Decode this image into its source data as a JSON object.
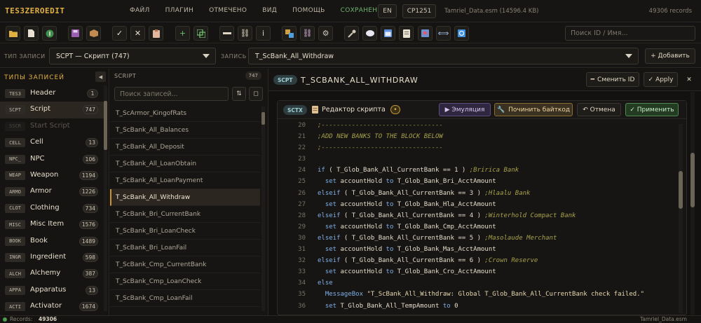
{
  "app": {
    "logo": "TES3ZEROEDIT",
    "records_count": "49306 records"
  },
  "menu": [
    "ФАЙЛ",
    "ПЛАГИН",
    "ОТМЕЧЕНО",
    "ВИД",
    "ПОМОЩЬ",
    "СОХРАНЕНИЯ"
  ],
  "menu_highlight": "СОХРАНЕНИЯ",
  "lang": "EN",
  "codepage": "CP1251",
  "file_info": "Tamriel_Data.esm (14596.4 KB)",
  "search_id": {
    "placeholder": "Поиск ID / Имя..."
  },
  "record_bar": {
    "type_label": "ТИП ЗАПИСИ",
    "type_value": "SCPT — Скрипт (747)",
    "record_label": "ЗАПИСЬ",
    "record_value": "T_ScBank_All_Withdraw",
    "add_button": "+ Добавить"
  },
  "left_panel": {
    "title": "ТИПЫ ЗАПИСЕЙ",
    "items": [
      {
        "code": "TES3",
        "name": "Header",
        "count": "1"
      },
      {
        "code": "SCPT",
        "name": "Script",
        "count": "747"
      },
      {
        "code": "SSCR",
        "name": "Start Script",
        "count": ""
      },
      {
        "code": "CELL",
        "name": "Cell",
        "count": "13"
      },
      {
        "code": "NPC_",
        "name": "NPC",
        "count": "106"
      },
      {
        "code": "WEAP",
        "name": "Weapon",
        "count": "1194"
      },
      {
        "code": "ARMO",
        "name": "Armor",
        "count": "1226"
      },
      {
        "code": "CLOT",
        "name": "Clothing",
        "count": "734"
      },
      {
        "code": "MISC",
        "name": "Misc Item",
        "count": "1576"
      },
      {
        "code": "BOOK",
        "name": "Book",
        "count": "1489"
      },
      {
        "code": "INGR",
        "name": "Ingredient",
        "count": "598"
      },
      {
        "code": "ALCH",
        "name": "Alchemy",
        "count": "387"
      },
      {
        "code": "APPA",
        "name": "Apparatus",
        "count": "13"
      },
      {
        "code": "ACTI",
        "name": "Activator",
        "count": "1674"
      }
    ]
  },
  "mid_panel": {
    "title": "SCRIPT",
    "count": "747",
    "search_placeholder": "Поиск записей...",
    "sort_icon": "⇅",
    "filter_icon": "◻",
    "items": [
      "T_ScArmor_KingofRats",
      "T_ScBank_All_Balances",
      "T_ScBank_All_Deposit",
      "T_ScBank_All_LoanObtain",
      "T_ScBank_All_LoanPayment",
      "T_ScBank_All_Withdraw",
      "T_ScBank_Bri_CurrentBank",
      "T_ScBank_Bri_LoanCheck",
      "T_ScBank_Bri_LoanFail",
      "T_ScBank_Cmp_CurrentBank",
      "T_ScBank_Cmp_LoanCheck",
      "T_ScBank_Cmp_LoanFail"
    ]
  },
  "editor_header": {
    "badge": "SCPT",
    "title": "T_SCBANK_ALL_WITHDRAW",
    "change_id": "Сменить ID",
    "apply": "Apply",
    "close": "✕"
  },
  "script_editor": {
    "badge": "SCTX",
    "title": "Редактор скрипта",
    "indicator": "•",
    "emulate": "▶ Эмуляция",
    "fix_bytecode": "Починить байткод",
    "cancel": "↶ Отмена",
    "apply": "✓ Применить"
  },
  "code_lines": [
    {
      "n": "20",
      "t": ";--------------------------------",
      "type": "comment"
    },
    {
      "n": "21",
      "t": ";ADD NEW BANKS TO THE BLOCK BELOW",
      "type": "comment"
    },
    {
      "n": "22",
      "t": ";--------------------------------",
      "type": "comment"
    },
    {
      "n": "23",
      "t": "",
      "type": "blank"
    },
    {
      "n": "24",
      "kw": "if",
      "rest": " ( T_Glob_Bank_All_CurrentBank == 1 ) ",
      "cm": ";Bririca Bank",
      "type": "cond"
    },
    {
      "n": "25",
      "kw": "  set",
      "rest": " accountHold ",
      "kw2": "to",
      "rest2": " T_Glob_Bank_Bri_AcctAmount",
      "type": "set"
    },
    {
      "n": "26",
      "kw": "elseif",
      "rest": " ( T_Glob_Bank_All_CurrentBank == 3 ) ",
      "cm": ";Hlaalu Bank",
      "type": "cond"
    },
    {
      "n": "27",
      "kw": "  set",
      "rest": " accountHold ",
      "kw2": "to",
      "rest2": " T_Glob_Bank_Hla_AcctAmount",
      "type": "set"
    },
    {
      "n": "28",
      "kw": "elseif",
      "rest": " ( T_Glob_Bank_All_CurrentBank == 4 ) ",
      "cm": ";Winterhold Compact Bank",
      "type": "cond"
    },
    {
      "n": "29",
      "kw": "  set",
      "rest": " accountHold ",
      "kw2": "to",
      "rest2": " T_Glob_Bank_Cmp_AcctAmount",
      "type": "set"
    },
    {
      "n": "30",
      "kw": "elseif",
      "rest": " ( T_Glob_Bank_All_CurrentBank == 5 ) ",
      "cm": ";Masolaude Merchant",
      "type": "cond"
    },
    {
      "n": "31",
      "kw": "  set",
      "rest": " accountHold ",
      "kw2": "to",
      "rest2": " T_Glob_Bank_Mas_AcctAmount",
      "type": "set"
    },
    {
      "n": "32",
      "kw": "elseif",
      "rest": " ( T_Glob_Bank_All_CurrentBank == 6 ) ",
      "cm": ";Crown Reserve",
      "type": "cond"
    },
    {
      "n": "33",
      "kw": "  set",
      "rest": " accountHold ",
      "kw2": "to",
      "rest2": " T_Glob_Bank_Cro_AcctAmount",
      "type": "set"
    },
    {
      "n": "34",
      "kw": "else",
      "type": "kwonly"
    },
    {
      "n": "35",
      "kw": "  MessageBox",
      "str": " \"T_ScBank_All_Withdraw: Global T_Glob_Bank_All_CurrentBank check failed.\"",
      "type": "msg"
    },
    {
      "n": "36",
      "kw": "  set",
      "rest": " T_Glob_Bank_All_TempAmount ",
      "kw2": "to",
      "rest2": " 0",
      "type": "set"
    }
  ],
  "statusbar": {
    "records_label": "Records:",
    "records_value": "49306",
    "file": "Tamriel_Data.esm"
  },
  "colors": {
    "accent": "#e0b040",
    "selection": "#2b2620",
    "keyword": "#7fb0e8",
    "comment": "#a8a24a",
    "success": "#4f9a4f"
  }
}
